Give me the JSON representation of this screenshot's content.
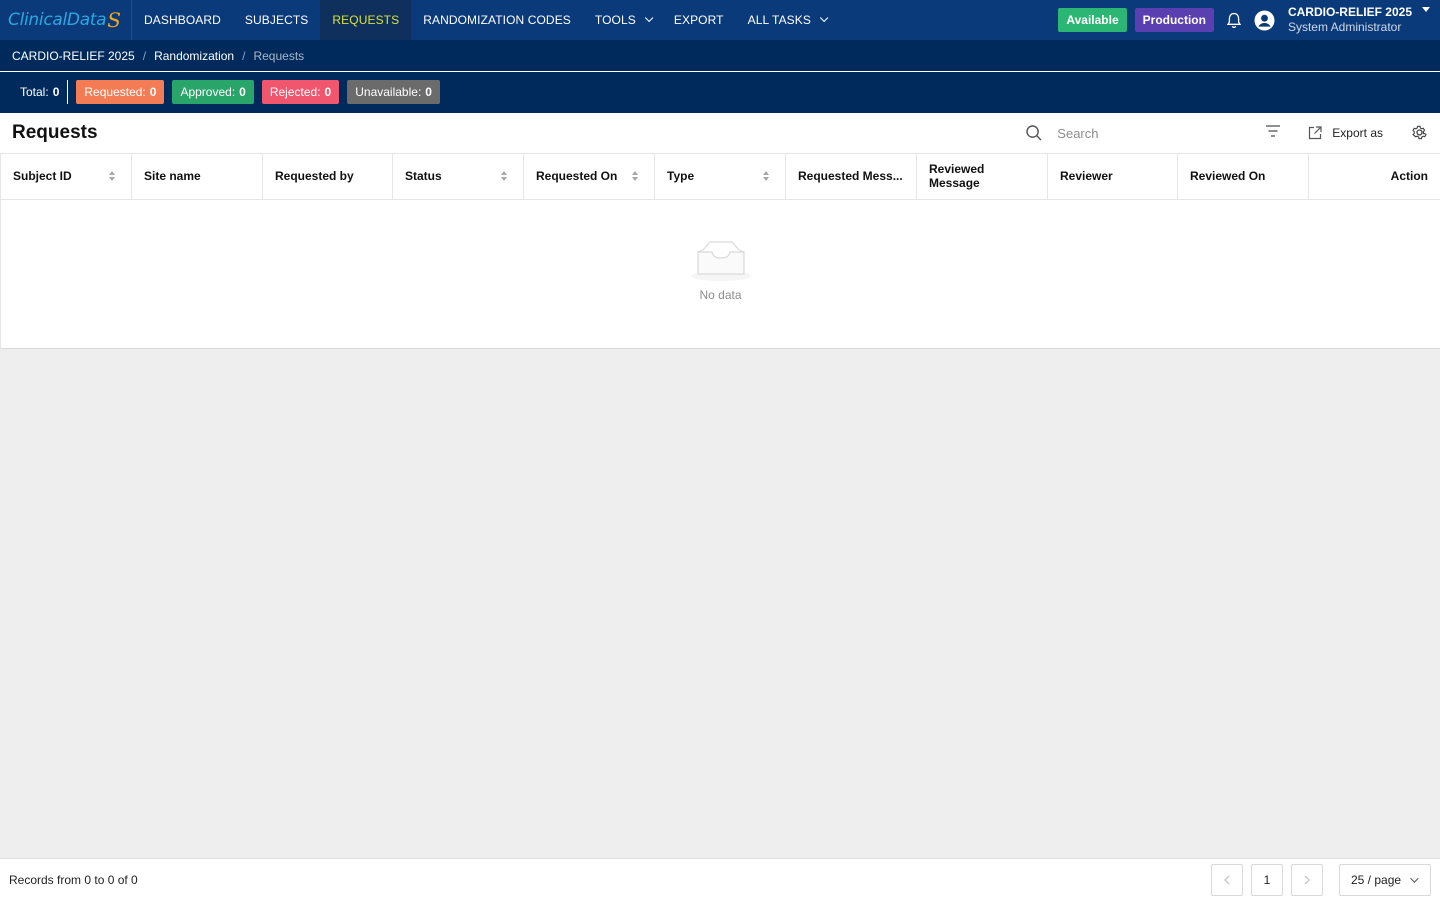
{
  "brand": {
    "logo_text": "ClinicalData",
    "logo_mark": "S"
  },
  "nav": {
    "items": [
      {
        "label": "DASHBOARD"
      },
      {
        "label": "SUBJECTS"
      },
      {
        "label": "REQUESTS"
      },
      {
        "label": "RANDOMIZATION CODES"
      },
      {
        "label": "TOOLS"
      },
      {
        "label": "EXPORT"
      },
      {
        "label": "ALL TASKS"
      }
    ],
    "active": "REQUESTS",
    "available_label": "Available",
    "production_label": "Production",
    "project": "CARDIO-RELIEF 2025",
    "role": "System Administrator"
  },
  "breadcrumb": [
    "CARDIO-RELIEF 2025",
    "Randomization",
    "Requests"
  ],
  "stats": {
    "total_label": "Total:",
    "total": "0",
    "requested_label": "Requested:",
    "requested": "0",
    "approved_label": "Approved:",
    "approved": "0",
    "rejected_label": "Rejected:",
    "rejected": "0",
    "unavailable_label": "Unavailable:",
    "unavailable": "0"
  },
  "panel": {
    "title": "Requests",
    "search_placeholder": "Search",
    "export_label": "Export as"
  },
  "table": {
    "columns": [
      "Subject ID",
      "Site name",
      "Requested by",
      "Status",
      "Requested On",
      "Type",
      "Requested Mess...",
      "Reviewed Message",
      "Reviewer",
      "Reviewed On",
      "Action"
    ],
    "empty_text": "No data"
  },
  "footer": {
    "records": "Records from 0 to 0 of 0",
    "current_page": "1",
    "page_size": "25 / page"
  },
  "colors": {
    "nav_bg": "#0a3a7a",
    "crumb_bg": "#002a5c",
    "active_nav_text": "#d8e23a",
    "available": "#2bb673",
    "production": "#5a3fb0",
    "requested": "#f47c55",
    "approved": "#2aa56a",
    "rejected": "#f0566e",
    "unavailable": "#6b6b6b"
  }
}
